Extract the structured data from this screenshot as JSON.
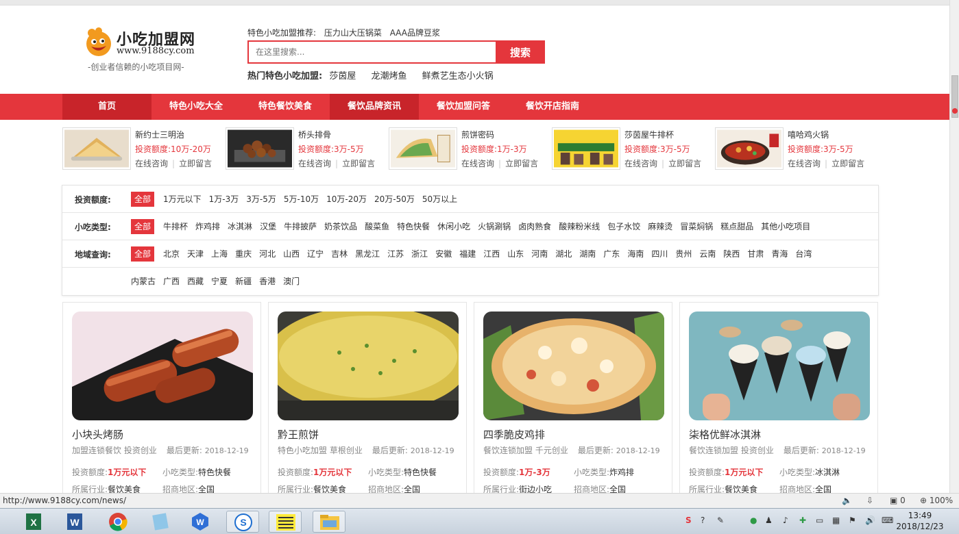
{
  "logo": {
    "name": "小吃加盟网",
    "url": "www.9188cy.com",
    "slogan": "-创业者信赖的小吃项目网-"
  },
  "header": {
    "recommend_label": "特色小吃加盟推荐:",
    "recommend_items": [
      "压力山大压锅菜",
      "AAA品牌豆浆"
    ],
    "search_placeholder": "在这里搜索...",
    "search_button": "搜索",
    "hot_label": "热门特色小吃加盟:",
    "hot_items": [
      "莎茵屋",
      "龙潮烤鱼",
      "鲜煮艺生态小火锅"
    ]
  },
  "nav": {
    "items": [
      "首页",
      "特色小吃大全",
      "特色餐饮美食",
      "餐饮品牌资讯",
      "餐饮加盟问答",
      "餐饮开店指南"
    ]
  },
  "featured": [
    {
      "title": "新约士三明治",
      "invest": "投资额度:10万-20万",
      "consult": "在线咨询",
      "msg": "立即留言"
    },
    {
      "title": "桥头排骨",
      "invest": "投资额度:3万-5万",
      "consult": "在线咨询",
      "msg": "立即留言"
    },
    {
      "title": "煎饼密码",
      "invest": "投资额度:1万-3万",
      "consult": "在线咨询",
      "msg": "立即留言"
    },
    {
      "title": "莎茵屋牛排杯",
      "invest": "投资额度:3万-5万",
      "consult": "在线咨询",
      "msg": "立即留言"
    },
    {
      "title": "嘻哈鸡火锅",
      "invest": "投资额度:3万-5万",
      "consult": "在线咨询",
      "msg": "立即留言"
    }
  ],
  "filters": {
    "invest": {
      "label": "投资额度:",
      "all": "全部",
      "options": [
        "1万元以下",
        "1万-3万",
        "3万-5万",
        "5万-10万",
        "10万-20万",
        "20万-50万",
        "50万以上"
      ]
    },
    "type": {
      "label": "小吃类型:",
      "all": "全部",
      "options": [
        "牛排杯",
        "炸鸡排",
        "冰淇淋",
        "汉堡",
        "牛排披萨",
        "奶茶饮品",
        "酸菜鱼",
        "特色快餐",
        "休闲小吃",
        "火锅涮锅",
        "卤肉熟食",
        "酸辣粉米线",
        "包子水饺",
        "麻辣烫",
        "冒菜焖锅",
        "糕点甜品",
        "其他小吃项目"
      ]
    },
    "region": {
      "label": "地域查询:",
      "all": "全部",
      "options": [
        "北京",
        "天津",
        "上海",
        "重庆",
        "河北",
        "山西",
        "辽宁",
        "吉林",
        "黑龙江",
        "江苏",
        "浙江",
        "安徽",
        "福建",
        "江西",
        "山东",
        "河南",
        "湖北",
        "湖南",
        "广东",
        "海南",
        "四川",
        "贵州",
        "云南",
        "陕西",
        "甘肃",
        "青海",
        "台湾"
      ],
      "options2": [
        "内蒙古",
        "广西",
        "西藏",
        "宁夏",
        "新疆",
        "香港",
        "澳门"
      ]
    }
  },
  "cards": [
    {
      "title": "小块头烤肠",
      "tag1": "加盟连锁餐饮",
      "tag2": "投资创业",
      "updated_label": "最后更新:",
      "date": "2018-12-19",
      "invest_label": "投资额度:",
      "invest": "1万元以下",
      "type_label": "小吃类型:",
      "type": "特色快餐",
      "industry_label": "所属行业:",
      "industry": "餐饮美食",
      "region_label": "招商地区:",
      "region": "全国"
    },
    {
      "title": "黔王煎饼",
      "tag1": "特色小吃加盟",
      "tag2": "草根创业",
      "updated_label": "最后更新:",
      "date": "2018-12-19",
      "invest_label": "投资额度:",
      "invest": "1万元以下",
      "type_label": "小吃类型:",
      "type": "特色快餐",
      "industry_label": "所属行业:",
      "industry": "餐饮美食",
      "region_label": "招商地区:",
      "region": "全国"
    },
    {
      "title": "四季脆皮鸡排",
      "tag1": "餐饮连锁加盟",
      "tag2": "千元创业",
      "updated_label": "最后更新:",
      "date": "2018-12-19",
      "invest_label": "投资额度:",
      "invest": "1万-3万",
      "type_label": "小吃类型:",
      "type": "炸鸡排",
      "industry_label": "所属行业:",
      "industry": "街边小吃",
      "region_label": "招商地区:",
      "region": "全国"
    },
    {
      "title": "柒格优鲜冰淇淋",
      "tag1": "餐饮连锁加盟",
      "tag2": "投资创业",
      "updated_label": "最后更新:",
      "date": "2018-12-19",
      "invest_label": "投资额度:",
      "invest": "1万元以下",
      "type_label": "小吃类型:",
      "type": "冰淇淋",
      "industry_label": "所属行业:",
      "industry": "餐饮美食",
      "region_label": "招商地区:",
      "region": "全国"
    }
  ],
  "statusbar": {
    "url": "http://www.9188cy.com/news/",
    "count": "0",
    "zoom": "100%"
  },
  "taskbar": {
    "time": "13:49",
    "date": "2018/12/23"
  },
  "colors": {
    "brand_red": "#e4363c",
    "nav_active": "#c8242a"
  }
}
